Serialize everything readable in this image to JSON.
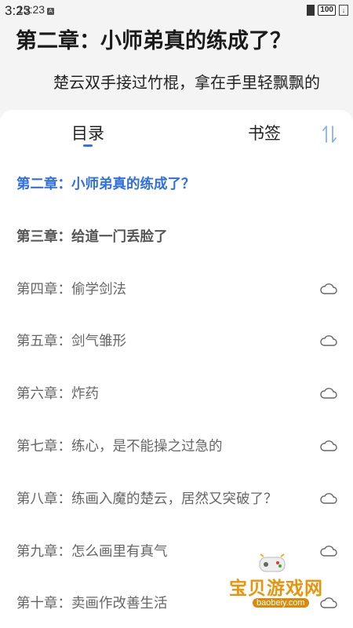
{
  "status_bar": {
    "time_main": "3:23",
    "time_overlay": "15:23",
    "notification_icon": "A",
    "battery": "100",
    "icons": [
      "signal-icon",
      "battery-icon",
      "download-icon"
    ]
  },
  "reader": {
    "chapter_title": "第二章：小师弟真的练成了？",
    "paragraph": "楚云双手接过竹棍，拿在手里轻飘飘的"
  },
  "panel": {
    "tabs": [
      {
        "label": "目录",
        "active": true
      },
      {
        "label": "书签",
        "active": false
      }
    ],
    "sort_icon": "sort-order-icon",
    "accent_color": "#2f6fe0",
    "chapters": [
      {
        "title": "第二章：小师弟真的练成了？",
        "state": "current"
      },
      {
        "title": "第三章：给道一门丢脸了",
        "state": "downloaded"
      },
      {
        "title": "第四章：偷学剑法",
        "state": "cloud"
      },
      {
        "title": "第五章：剑气雏形",
        "state": "cloud"
      },
      {
        "title": "第六章：炸药",
        "state": "cloud"
      },
      {
        "title": "第七章：练心，是不能操之过急的",
        "state": "cloud"
      },
      {
        "title": "第八章：练画入魔的楚云，居然又突破了？",
        "state": "cloud"
      },
      {
        "title": "第九章：怎么画里有真气",
        "state": "cloud"
      },
      {
        "title": "第十章：卖画作改善生活",
        "state": "cloud"
      }
    ]
  },
  "watermark": {
    "title": "宝贝游戏网",
    "url": "baobeiy.com"
  }
}
